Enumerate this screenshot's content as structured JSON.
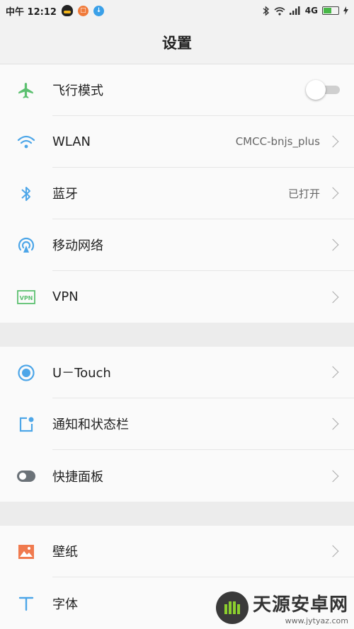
{
  "statusbar": {
    "time": "中午 12:12",
    "network": "4G"
  },
  "header": {
    "title": "设置"
  },
  "groups": [
    {
      "items": [
        {
          "label": "飞行模式",
          "icon": "airplane-icon",
          "control": "toggle",
          "enabled": false
        },
        {
          "label": "WLAN",
          "icon": "wifi-icon",
          "value": "CMCC-bnjs_plus"
        },
        {
          "label": "蓝牙",
          "icon": "bluetooth-icon",
          "value": "已打开"
        },
        {
          "label": "移动网络",
          "icon": "mobile-network-icon"
        },
        {
          "label": "VPN",
          "icon": "vpn-icon"
        }
      ]
    },
    {
      "items": [
        {
          "label": "U－Touch",
          "icon": "utouch-icon"
        },
        {
          "label": "通知和状态栏",
          "icon": "notification-icon"
        },
        {
          "label": "快捷面板",
          "icon": "quick-panel-icon"
        }
      ]
    },
    {
      "items": [
        {
          "label": "壁纸",
          "icon": "wallpaper-icon"
        },
        {
          "label": "字体",
          "icon": "font-icon"
        }
      ]
    }
  ],
  "watermark": {
    "title": "天源安卓网",
    "url": "www.jytyaz.com"
  },
  "colors": {
    "green": "#5cc070",
    "blue": "#4da6e8",
    "gray": "#6b7278",
    "orange": "#f07a4e"
  }
}
